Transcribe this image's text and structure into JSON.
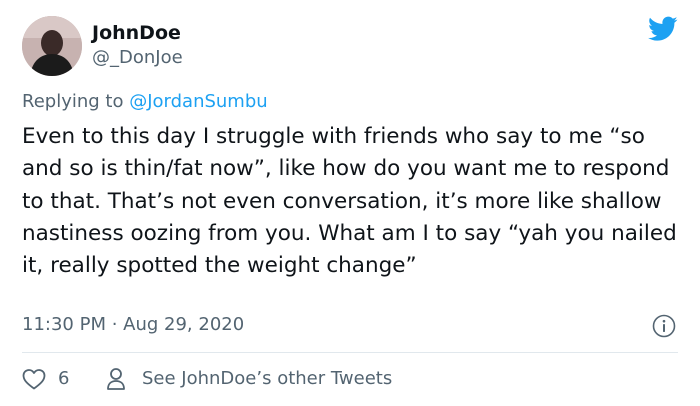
{
  "author": {
    "display_name": "JohnDoe",
    "handle": "@_DonJoe",
    "avatar_icon": "profile-photo"
  },
  "brand": {
    "icon": "twitter-bird-icon",
    "color": "#1da1f2"
  },
  "reply": {
    "prefix": "Replying to ",
    "to": "@JordanSumbu"
  },
  "tweet": {
    "text": "Even to this day I struggle with friends who say to me “so and so is thin/fat now”, like how do you want me to respond to that. That’s not even conversation, it’s more like shallow nastiness oozing from you. What am I to say “yah you nailed it, really spotted the weight change”",
    "timestamp": "11:30 PM · Aug 29, 2020"
  },
  "actions": {
    "like_count": "6",
    "profile_link": "See JohnDoe’s other Tweets"
  },
  "colors": {
    "text": "#0f1419",
    "muted": "#536471",
    "link": "#1da1f2",
    "divider": "#e1e8ed"
  }
}
